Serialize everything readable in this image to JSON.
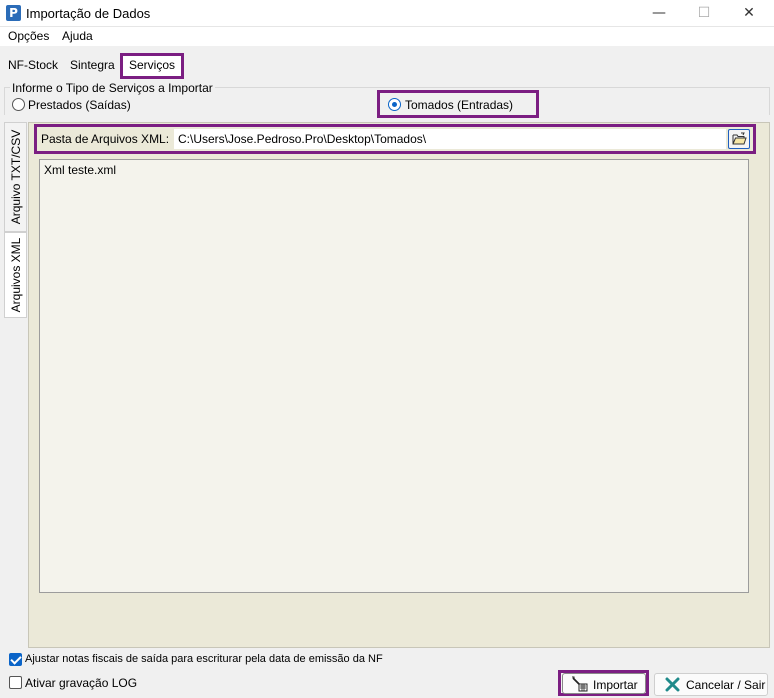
{
  "window": {
    "title": "Importação de Dados",
    "icon_letter": "P"
  },
  "icons": {
    "app": "app-p-icon",
    "minimize": "minimize-icon",
    "maximize": "maximize-icon",
    "close": "close-icon",
    "folder": "open-folder-icon",
    "import": "import-wand-icon",
    "cancel": "cancel-x-icon"
  },
  "menu": {
    "opcoes": "Opções",
    "ajuda": "Ajuda"
  },
  "tabs": {
    "nfstock": "NF-Stock",
    "sintegra": "Sintegra",
    "servicos": "Serviços"
  },
  "service_type": {
    "group_label": "Informe o Tipo de Serviços a Importar",
    "prestados": "Prestados (Saídas)",
    "tomados": "Tomados (Entradas)",
    "selected": "Tomados (Entradas)"
  },
  "side_tabs": {
    "txt_csv": "Arquivo TXT/CSV",
    "xml": "Arquivos XML"
  },
  "folder": {
    "label": "Pasta de Arquivos XML:",
    "value": "C:\\Users\\Jose.Pedroso.Pro\\Desktop\\Tomados\\"
  },
  "file_list": [
    "Xml teste.xml"
  ],
  "options": {
    "ajustar": "Ajustar notas fiscais de saída para escriturar pela data de emissão da NF",
    "ajustar_checked": true,
    "log": "Ativar gravação LOG",
    "log_checked": false
  },
  "buttons": {
    "importar": "Importar",
    "cancelar": "Cancelar / Sair"
  },
  "colors": {
    "highlight": "#7b1e82",
    "accent": "#0a64c8",
    "content_bg": "#ebe9d8"
  }
}
